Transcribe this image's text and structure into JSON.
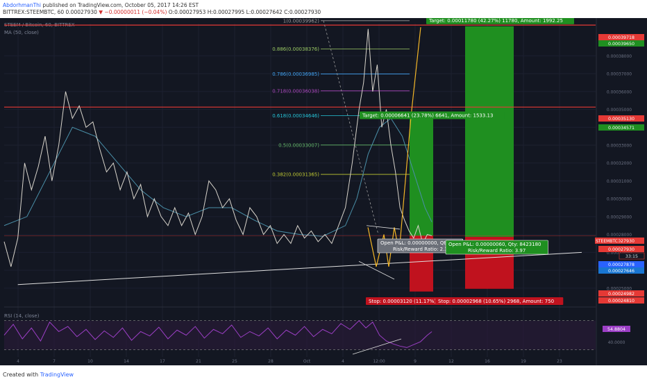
{
  "header": {
    "author": "AbdorhmanThi",
    "published": "published on TradingView.com, October 05, 2017 14:26 EST",
    "symbol_line": "BITTREX:STEEMBTC, 60",
    "price": "0.00027930",
    "change": "▼ −0.00000011 (−0.04%)",
    "ohlc": "O:0.00027953 H:0.00027995 L:0.00027642 C:0.00027930"
  },
  "footer": {
    "created_with": "Created with",
    "brand": "TradingView"
  },
  "chart_data": {
    "type": "line",
    "title": "STEEM / Bitcoin, 60, BITTREX",
    "ma_label": "MA (50, close)",
    "rsi_label": "RSI (14, close)",
    "rsi_value": "54.8804",
    "rsi_level_label": "40.0000",
    "symbol_tag": "STEEMBTC",
    "countdown": "33:15",
    "colors": {
      "background": "#131722",
      "price_line": "#d9d5cc",
      "ma": "#4a8fa8",
      "rsi": "#9c3fc6",
      "horizontal_lines": "#e53935",
      "pattern": "#f5b727",
      "target_zone": "#1f8f20",
      "stop_zone": "#c0121e"
    },
    "x_ticks": [
      "4",
      "7",
      "10",
      "14",
      "17",
      "21",
      "25",
      "28",
      "Oct",
      "4",
      "12:00",
      "9",
      "12",
      "16",
      "19",
      "23"
    ],
    "y_ticks": [
      "0.00038000",
      "0.00037000",
      "0.00036000",
      "0.00035000",
      "0.00034000",
      "0.00033000",
      "0.00032000",
      "0.00031000",
      "0.00030000",
      "0.00029000",
      "0.00028000",
      "0.00027000",
      "0.00026000",
      "0.00025000"
    ],
    "ylim": [
      0.000241,
      0.000398
    ],
    "price_tags": [
      {
        "value": "0.00039718",
        "color": "#e53935"
      },
      {
        "value": "0.00039650",
        "color": "#1f8f20"
      },
      {
        "value": "0.00035130",
        "color": "#e53935"
      },
      {
        "value": "0.00034571",
        "color": "#1f8f20"
      },
      {
        "value": "0.00027930",
        "color": "#e53935"
      },
      {
        "value": "0.00027930",
        "color": "#e53935"
      },
      {
        "value": "0.00027878",
        "color": "#2962ff"
      },
      {
        "value": "0.00027646",
        "color": "#1976d2"
      },
      {
        "value": "0.00024982",
        "color": "#e53935"
      },
      {
        "value": "0.00024810",
        "color": "#e53935"
      }
    ],
    "horizontal_levels": [
      0.00039718,
      0.0003513,
      0.0002793
    ],
    "fibonacci": [
      {
        "ratio": "1",
        "label": "1(0.00039962)",
        "value": 0.00039962,
        "color": "#9e9e9e"
      },
      {
        "ratio": "0.886",
        "label": "0.886(0.00038376)",
        "value": 0.00038376,
        "color": "#9ccc65"
      },
      {
        "ratio": "0.786",
        "label": "0.786(0.00036985)",
        "value": 0.00036985,
        "color": "#42a5f5"
      },
      {
        "ratio": "0.718",
        "label": "0.718(0.00036038)",
        "value": 0.00036038,
        "color": "#ab47bc"
      },
      {
        "ratio": "0.618",
        "label": "0.618(0.00034646)",
        "value": 0.00034646,
        "color": "#26c6da"
      },
      {
        "ratio": "0.5",
        "label": "0.5(0.00033007)",
        "value": 0.00033007,
        "color": "#66bb6a"
      },
      {
        "ratio": "0.382",
        "label": "0.382(0.00031365)",
        "value": 0.00031365,
        "color": "#c0ca33"
      }
    ],
    "positions": [
      {
        "target_label": "Target: 0.00006641 (23.78%) 6641, Amount: 1533.13",
        "stop_label": "Stop: 0.00003120 (11.17%) 3",
        "pnl_label": "Open P&L: 0.00000000, Qty: 4",
        "ratio_label": "Risk/Reward Ratio: 2.1",
        "entry": 0.0002793,
        "target": 0.00034571,
        "stop": 0.0002481
      },
      {
        "target_label": "Target: 0.00011780 (42.27%) 11780, Amount: 1992.25",
        "stop_label": "Stop: 0.00002968 (10.65%) 2968, Amount: 750",
        "pnl_label": "Open P&L: 0.00000060, Qty: 8423180",
        "ratio_label": "Risk/Reward Ratio: 3.97",
        "entry": 0.0002787,
        "target": 0.0003965,
        "stop": 0.00024962
      }
    ],
    "price_series": [
      {
        "x": 0,
        "y": 0.000276
      },
      {
        "x": 6,
        "y": 0.000262
      },
      {
        "x": 12,
        "y": 0.000278
      },
      {
        "x": 18,
        "y": 0.00032
      },
      {
        "x": 24,
        "y": 0.000305
      },
      {
        "x": 30,
        "y": 0.000318
      },
      {
        "x": 36,
        "y": 0.000335
      },
      {
        "x": 42,
        "y": 0.00031
      },
      {
        "x": 48,
        "y": 0.00033
      },
      {
        "x": 54,
        "y": 0.00036
      },
      {
        "x": 60,
        "y": 0.000345
      },
      {
        "x": 66,
        "y": 0.000352
      },
      {
        "x": 72,
        "y": 0.00034
      },
      {
        "x": 78,
        "y": 0.000343
      },
      {
        "x": 84,
        "y": 0.000328
      },
      {
        "x": 90,
        "y": 0.000315
      },
      {
        "x": 96,
        "y": 0.00032
      },
      {
        "x": 102,
        "y": 0.000305
      },
      {
        "x": 108,
        "y": 0.000315
      },
      {
        "x": 114,
        "y": 0.0003
      },
      {
        "x": 120,
        "y": 0.000308
      },
      {
        "x": 126,
        "y": 0.00029
      },
      {
        "x": 132,
        "y": 0.0003
      },
      {
        "x": 138,
        "y": 0.00029
      },
      {
        "x": 144,
        "y": 0.000285
      },
      {
        "x": 150,
        "y": 0.000295
      },
      {
        "x": 156,
        "y": 0.000285
      },
      {
        "x": 162,
        "y": 0.000292
      },
      {
        "x": 168,
        "y": 0.00028
      },
      {
        "x": 174,
        "y": 0.00029
      },
      {
        "x": 180,
        "y": 0.00031
      },
      {
        "x": 186,
        "y": 0.000305
      },
      {
        "x": 192,
        "y": 0.000295
      },
      {
        "x": 198,
        "y": 0.0003
      },
      {
        "x": 204,
        "y": 0.000288
      },
      {
        "x": 210,
        "y": 0.00028
      },
      {
        "x": 216,
        "y": 0.000295
      },
      {
        "x": 222,
        "y": 0.00029
      },
      {
        "x": 228,
        "y": 0.00028
      },
      {
        "x": 234,
        "y": 0.000285
      },
      {
        "x": 240,
        "y": 0.000275
      },
      {
        "x": 246,
        "y": 0.00028
      },
      {
        "x": 252,
        "y": 0.000275
      },
      {
        "x": 258,
        "y": 0.000285
      },
      {
        "x": 264,
        "y": 0.000278
      },
      {
        "x": 270,
        "y": 0.000282
      },
      {
        "x": 276,
        "y": 0.000276
      },
      {
        "x": 282,
        "y": 0.00028
      },
      {
        "x": 288,
        "y": 0.000275
      },
      {
        "x": 294,
        "y": 0.000285
      },
      {
        "x": 300,
        "y": 0.000295
      },
      {
        "x": 306,
        "y": 0.00032
      },
      {
        "x": 312,
        "y": 0.00035
      },
      {
        "x": 316,
        "y": 0.000365
      },
      {
        "x": 320,
        "y": 0.000395
      },
      {
        "x": 324,
        "y": 0.00036
      },
      {
        "x": 328,
        "y": 0.000375
      },
      {
        "x": 332,
        "y": 0.00034
      },
      {
        "x": 336,
        "y": 0.00035
      },
      {
        "x": 340,
        "y": 0.00033
      },
      {
        "x": 344,
        "y": 0.000315
      },
      {
        "x": 348,
        "y": 0.000295
      },
      {
        "x": 352,
        "y": 0.000288
      },
      {
        "x": 356,
        "y": 0.000282
      },
      {
        "x": 360,
        "y": 0.000278
      },
      {
        "x": 364,
        "y": 0.000285
      },
      {
        "x": 368,
        "y": 0.000275
      },
      {
        "x": 372,
        "y": 0.00028
      },
      {
        "x": 376,
        "y": 0.0002793
      }
    ],
    "ma_series": [
      {
        "x": 0,
        "y": 0.000285
      },
      {
        "x": 20,
        "y": 0.00029
      },
      {
        "x": 40,
        "y": 0.000315
      },
      {
        "x": 60,
        "y": 0.00034
      },
      {
        "x": 80,
        "y": 0.000335
      },
      {
        "x": 100,
        "y": 0.00032
      },
      {
        "x": 120,
        "y": 0.000305
      },
      {
        "x": 140,
        "y": 0.000295
      },
      {
        "x": 160,
        "y": 0.00029
      },
      {
        "x": 180,
        "y": 0.000295
      },
      {
        "x": 200,
        "y": 0.000295
      },
      {
        "x": 220,
        "y": 0.000288
      },
      {
        "x": 240,
        "y": 0.000282
      },
      {
        "x": 260,
        "y": 0.00028
      },
      {
        "x": 280,
        "y": 0.000279
      },
      {
        "x": 300,
        "y": 0.000285
      },
      {
        "x": 310,
        "y": 0.0003
      },
      {
        "x": 320,
        "y": 0.000325
      },
      {
        "x": 330,
        "y": 0.00034
      },
      {
        "x": 340,
        "y": 0.000345
      },
      {
        "x": 350,
        "y": 0.000335
      },
      {
        "x": 360,
        "y": 0.000315
      },
      {
        "x": 370,
        "y": 0.000295
      },
      {
        "x": 376,
        "y": 0.000287
      }
    ],
    "rsi_series": [
      {
        "x": 0,
        "y": 50
      },
      {
        "x": 8,
        "y": 65
      },
      {
        "x": 16,
        "y": 45
      },
      {
        "x": 24,
        "y": 60
      },
      {
        "x": 32,
        "y": 42
      },
      {
        "x": 40,
        "y": 68
      },
      {
        "x": 48,
        "y": 55
      },
      {
        "x": 56,
        "y": 62
      },
      {
        "x": 64,
        "y": 48
      },
      {
        "x": 72,
        "y": 58
      },
      {
        "x": 80,
        "y": 44
      },
      {
        "x": 88,
        "y": 56
      },
      {
        "x": 96,
        "y": 47
      },
      {
        "x": 104,
        "y": 60
      },
      {
        "x": 112,
        "y": 43
      },
      {
        "x": 120,
        "y": 55
      },
      {
        "x": 128,
        "y": 49
      },
      {
        "x": 136,
        "y": 61
      },
      {
        "x": 144,
        "y": 45
      },
      {
        "x": 152,
        "y": 57
      },
      {
        "x": 160,
        "y": 50
      },
      {
        "x": 168,
        "y": 62
      },
      {
        "x": 176,
        "y": 46
      },
      {
        "x": 184,
        "y": 58
      },
      {
        "x": 192,
        "y": 52
      },
      {
        "x": 200,
        "y": 64
      },
      {
        "x": 208,
        "y": 47
      },
      {
        "x": 216,
        "y": 55
      },
      {
        "x": 224,
        "y": 49
      },
      {
        "x": 232,
        "y": 60
      },
      {
        "x": 240,
        "y": 45
      },
      {
        "x": 248,
        "y": 57
      },
      {
        "x": 256,
        "y": 50
      },
      {
        "x": 264,
        "y": 62
      },
      {
        "x": 272,
        "y": 48
      },
      {
        "x": 280,
        "y": 58
      },
      {
        "x": 288,
        "y": 52
      },
      {
        "x": 296,
        "y": 66
      },
      {
        "x": 304,
        "y": 58
      },
      {
        "x": 312,
        "y": 70
      },
      {
        "x": 318,
        "y": 60
      },
      {
        "x": 324,
        "y": 68
      },
      {
        "x": 330,
        "y": 50
      },
      {
        "x": 336,
        "y": 42
      },
      {
        "x": 342,
        "y": 38
      },
      {
        "x": 348,
        "y": 35
      },
      {
        "x": 354,
        "y": 33
      },
      {
        "x": 360,
        "y": 37
      },
      {
        "x": 366,
        "y": 41
      },
      {
        "x": 372,
        "y": 50
      },
      {
        "x": 376,
        "y": 54.88
      }
    ],
    "rsi_ylim": [
      20,
      85
    ],
    "trendline": {
      "x0": 12,
      "y0": 0.000252,
      "x1": 380,
      "y1": 0.00027
    },
    "xlim": [
      0,
      520
    ]
  }
}
